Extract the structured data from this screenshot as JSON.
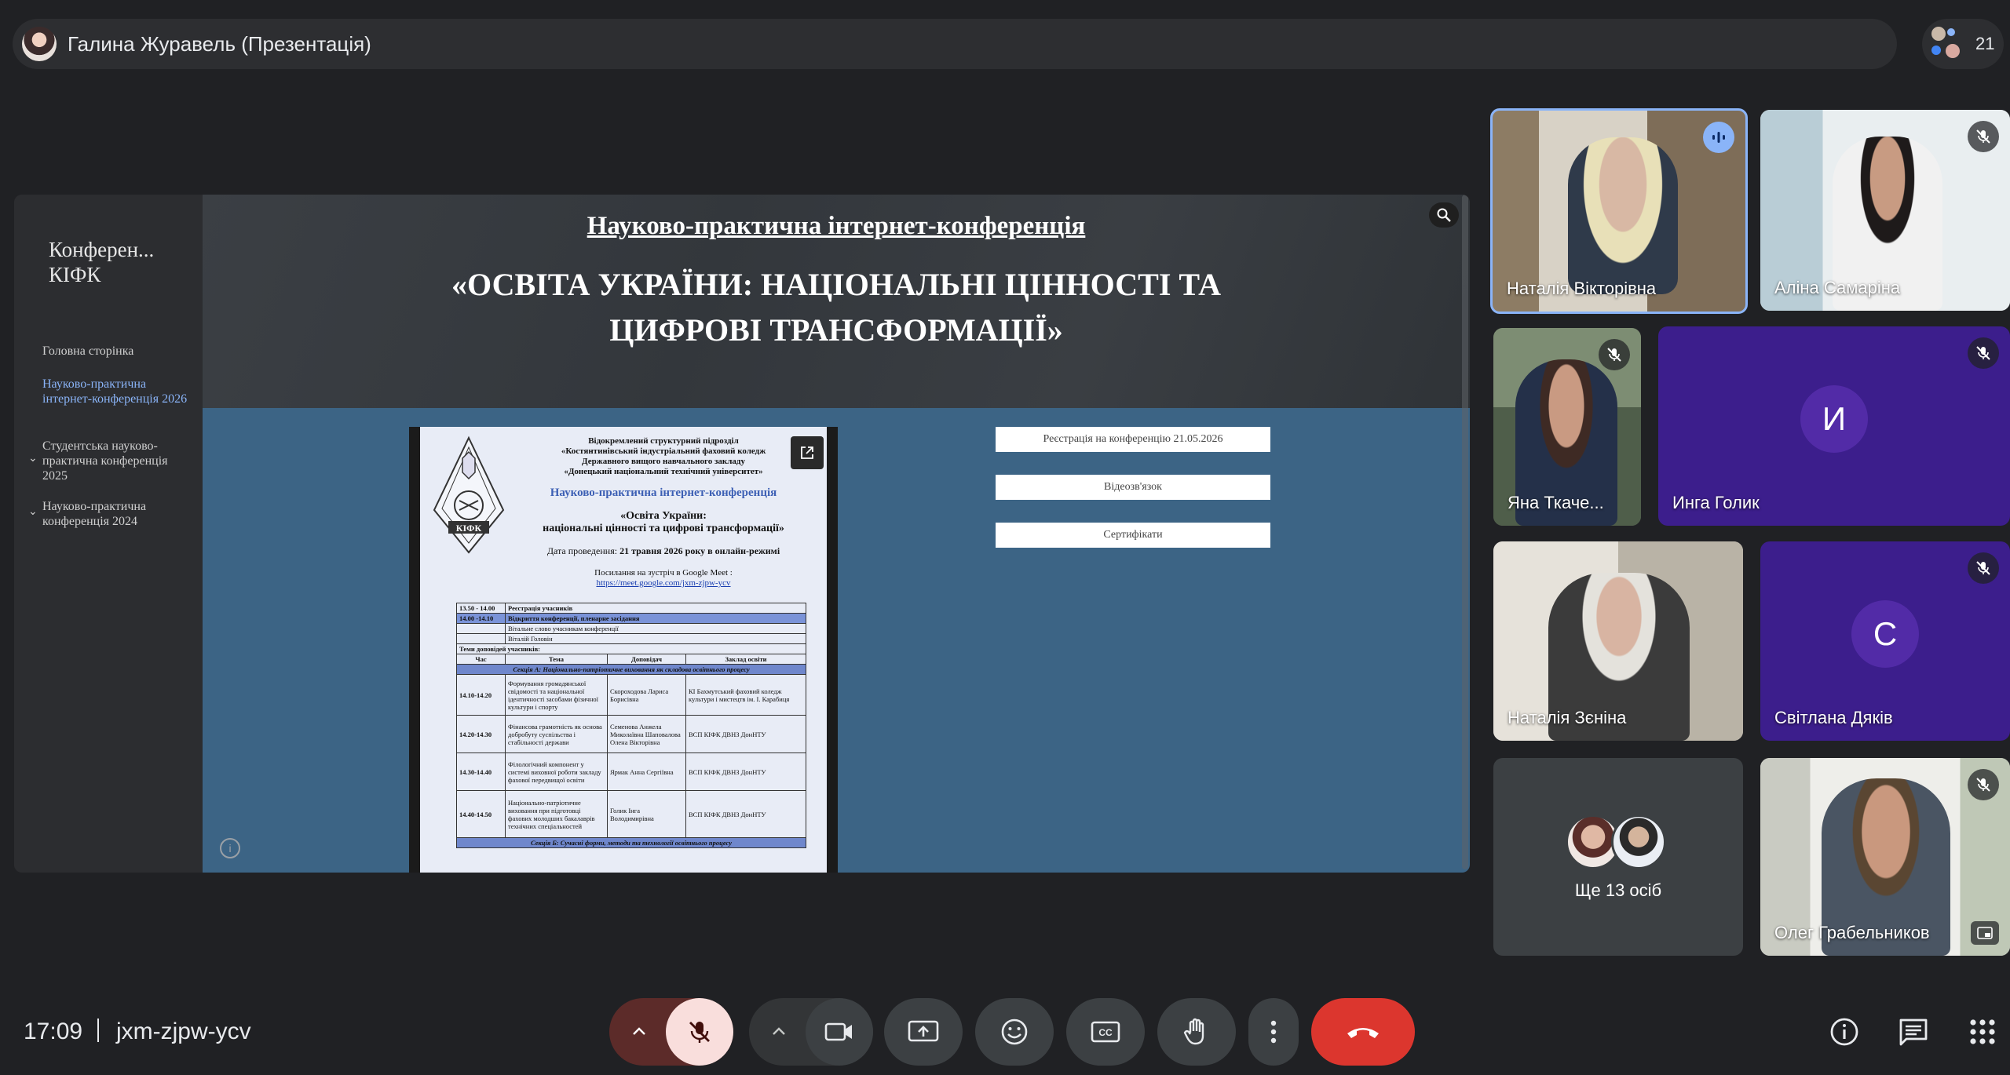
{
  "topbar": {
    "presenter_title": "Галина Журавель (Презентація)",
    "participants_count": "21"
  },
  "slide": {
    "sidebar_title": "Конферен... КІФК",
    "nav": [
      {
        "label": "Головна сторінка",
        "active": false,
        "expandable": false
      },
      {
        "label": "Науково-практична інтернет-конференція 2026",
        "active": true,
        "expandable": false
      },
      {
        "label": "Студентська науково-практична конференція 2025",
        "active": false,
        "expandable": true
      },
      {
        "label": "Науково-практична конференція 2024",
        "active": false,
        "expandable": true
      }
    ],
    "subtitle": "Науково-практична інтернет-конференція",
    "title": "«ОСВІТА УКРАЇНИ: НАЦІОНАЛЬНІ ЦІННОСТІ ТА ЦИФРОВІ ТРАНСФОРМАЦІЇ»",
    "buttons": [
      "Реєстрація на конференцію 21.05.2026",
      "Відеозв'язок",
      "Сертифікати"
    ],
    "doc": {
      "org": [
        "Відокремлений структурний підрозділ",
        "«Костянтинівський індустріальний фаховий коледж",
        "Державного вищого навчального закладу",
        "«Донецький національний технічний університет»"
      ],
      "heading": "Науково-практична інтернет-конференція",
      "theme_1": "«Освіта України:",
      "theme_2": "національні цінності та цифрові трансформації»",
      "date_label": "Дата проведення:",
      "date_value": "21 травня 2026 року в онлайн-режимі",
      "meet_label": "Посилання на зустріч в Google Meet :",
      "meet_link": "https://meet.google.com/jxm-zjpw-ycv",
      "logo_text": "КІФК",
      "rows": {
        "r1_time": "13.50 - 14.00",
        "r1_text": "Реєстрація учасників",
        "r2_time": "14.00 -14.10",
        "r2_text": "Відкриття конференції, пленарне засідання",
        "r3_text": "Вітальне слово учасникам конференції",
        "r4_text": "Віталій Головін",
        "r5_text": "Теми доповідей учасників:",
        "h_time": "Час",
        "h_topic": "Тема",
        "h_speaker": "Доповідач",
        "h_inst": "Заклад освіти",
        "sec_a": "Секція А: Національно-патріотичне виховання як складова освітнього процесу",
        "a1_time": "14.10-14.20",
        "a1_topic": "Формування громадянської свідомості та національної ідентичності засобами фізичної культури і спорту",
        "a1_speaker": "Скороходова Лариса Борисівна",
        "a1_inst": "КІ Бахмутський фаховий коледж культури і мистецтв ім. І. Карабиця",
        "a2_time": "14.20-14.30",
        "a2_topic": "Фінансова грамотність як основа добробуту суспільства і стабільності держави",
        "a2_speaker": "Семенова Анжела Миколаївна Шаповалова Олена Вікторівна",
        "a2_inst": "ВСП КІФК ДВНЗ ДонНТУ",
        "a3_time": "14.30-14.40",
        "a3_topic": "Філологічний компонент у системі виховної роботи закладу фахової передвищої освіти",
        "a3_speaker": "Ярмак Анна Сергіївна",
        "a3_inst": "ВСП КІФК ДВНЗ ДонНТУ",
        "a4_time": "14.40-14.50",
        "a4_topic": "Національно-патріотичне виховання при підготовці фахових молодших бакалаврів технічних спеціальностей",
        "a4_speaker": "Голик Інга Володимирівна",
        "a4_inst": "ВСП КІФК ДВНЗ ДонНТУ",
        "sec_b": "Секція Б: Сучасні форми, методи та технології освітнього процесу"
      }
    }
  },
  "tiles": [
    {
      "name": "Наталія Вікторівна",
      "speaking": true
    },
    {
      "name": "Аліна Самаріна",
      "muted": true
    },
    {
      "name": "Яна Ткаче...",
      "muted": true
    },
    {
      "name": "Инга Голик",
      "initial": "И",
      "muted": true
    },
    {
      "name": "Наталія Зєніна"
    },
    {
      "name": "Світлана Дяків",
      "initial": "С",
      "muted": true
    },
    {
      "name": "Ще 13 осіб"
    },
    {
      "name": "Олег Грабельников",
      "muted": true
    }
  ],
  "bottom": {
    "time": "17:09",
    "meeting_code": "jxm-zjpw-ycv"
  },
  "colors": {
    "background": "#202124",
    "tile_gray": "#3c4043",
    "purple_tile": "#3c1e8c",
    "avatar_purple": "#522ba7",
    "end_call": "#ea4335",
    "mic_off_bg": "#f9dedc",
    "mic_arrow_bg": "#5c2b29",
    "active_link": "#8ab4f8",
    "slide_blue": "#3c6485"
  }
}
